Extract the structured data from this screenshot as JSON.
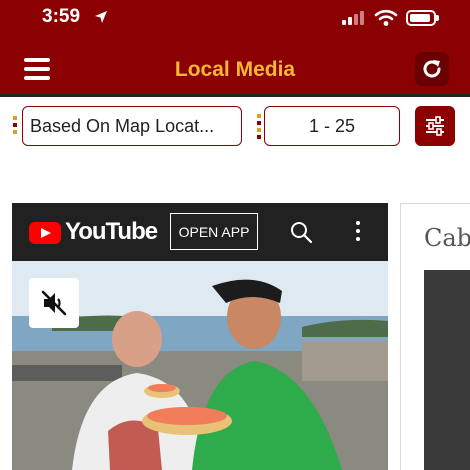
{
  "status_bar": {
    "time": "3:59"
  },
  "header": {
    "title": "Local Media"
  },
  "filters": {
    "location_select": "Based On Map Locat...",
    "range_select": "1 - 25"
  },
  "video_card": {
    "brand": "YouTube",
    "open_app_label": "OPEN APP"
  },
  "second_card": {
    "title_fragment": "Cab"
  },
  "colors": {
    "header_bg": "#8b0000",
    "title_color": "#f7b733",
    "accent_dark": "#6a0000",
    "grip_gold": "#d8a21a"
  },
  "icons": {
    "menu": "hamburger-icon",
    "refresh": "refresh-icon",
    "filter": "sliders-icon",
    "search": "search-icon",
    "more": "more-vertical-icon",
    "mute": "muted-speaker-icon"
  }
}
